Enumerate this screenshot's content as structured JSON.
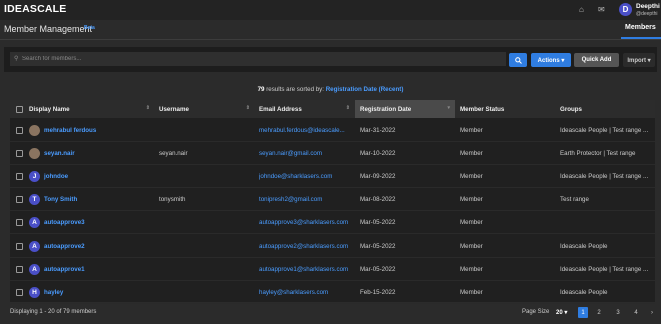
{
  "app": {
    "logo": "IDEASCALE"
  },
  "header": {
    "home_icon": "home-icon",
    "mail_icon": "mail-icon",
    "user": {
      "initial": "D",
      "name": "Deepthi",
      "handle": "@deepthi"
    }
  },
  "page": {
    "title": "Member Management",
    "beta": "Beta",
    "tab": "Members"
  },
  "toolbar": {
    "search_placeholder": "Search for members...",
    "actions_label": "Actions ▾",
    "quickadd_label": "Quick Add",
    "import_label": "Import ▾"
  },
  "results": {
    "count": "79",
    "text": " results are sorted by: ",
    "sort": "Registration Date (Recent)"
  },
  "table": {
    "columns": [
      "Display Name",
      "Username",
      "Email Address",
      "Registration Date",
      "Member Status",
      "Groups"
    ],
    "rows": [
      {
        "avatar": "",
        "photo": true,
        "name": "mehrabul ferdous",
        "username": "",
        "email": "mehrabul.ferdous@ideascale...",
        "date": "Mar-31-2022",
        "status": "Member",
        "groups": "Ideascale People | Test range ..."
      },
      {
        "avatar": "",
        "photo": true,
        "name": "seyan.nair",
        "username": "seyan.nair",
        "email": "seyan.nair@gmail.com",
        "date": "Mar-10-2022",
        "status": "Member",
        "groups": "Earth Protector | Test range"
      },
      {
        "avatar": "J",
        "photo": false,
        "name": "johndoe",
        "username": "",
        "email": "johndoe@sharklasers.com",
        "date": "Mar-09-2022",
        "status": "Member",
        "groups": "Ideascale People | Test range ..."
      },
      {
        "avatar": "T",
        "photo": false,
        "name": "Tony Smith",
        "username": "tonysmith",
        "email": "tonipresh2@gmail.com",
        "date": "Mar-08-2022",
        "status": "Member",
        "groups": "Test range"
      },
      {
        "avatar": "A",
        "photo": false,
        "name": "autoapprove3",
        "username": "",
        "email": "autoapprove3@sharklasers.com",
        "date": "Mar-05-2022",
        "status": "Member",
        "groups": ""
      },
      {
        "avatar": "A",
        "photo": false,
        "name": "autoapprove2",
        "username": "",
        "email": "autoapprove2@sharklasers.com",
        "date": "Mar-05-2022",
        "status": "Member",
        "groups": "Ideascale People"
      },
      {
        "avatar": "A",
        "photo": false,
        "name": "autoapprove1",
        "username": "",
        "email": "autoapprove1@sharklasers.com",
        "date": "Mar-05-2022",
        "status": "Member",
        "groups": "Ideascale People | Test range ..."
      },
      {
        "avatar": "H",
        "photo": false,
        "name": "hayley",
        "username": "",
        "email": "hayley@sharklasers.com",
        "date": "Feb-15-2022",
        "status": "Member",
        "groups": "Ideascale People"
      }
    ]
  },
  "footer": {
    "info": "Displaying 1 - 20 of 79 members",
    "page_size_label": "Page Size",
    "page_size": "20 ▾",
    "pages": [
      "1",
      "2",
      "3",
      "4"
    ],
    "next": "›"
  },
  "colors": {
    "accent": "#2f7de1",
    "link": "#4a9cff",
    "avatar": "#4a4fc7"
  }
}
